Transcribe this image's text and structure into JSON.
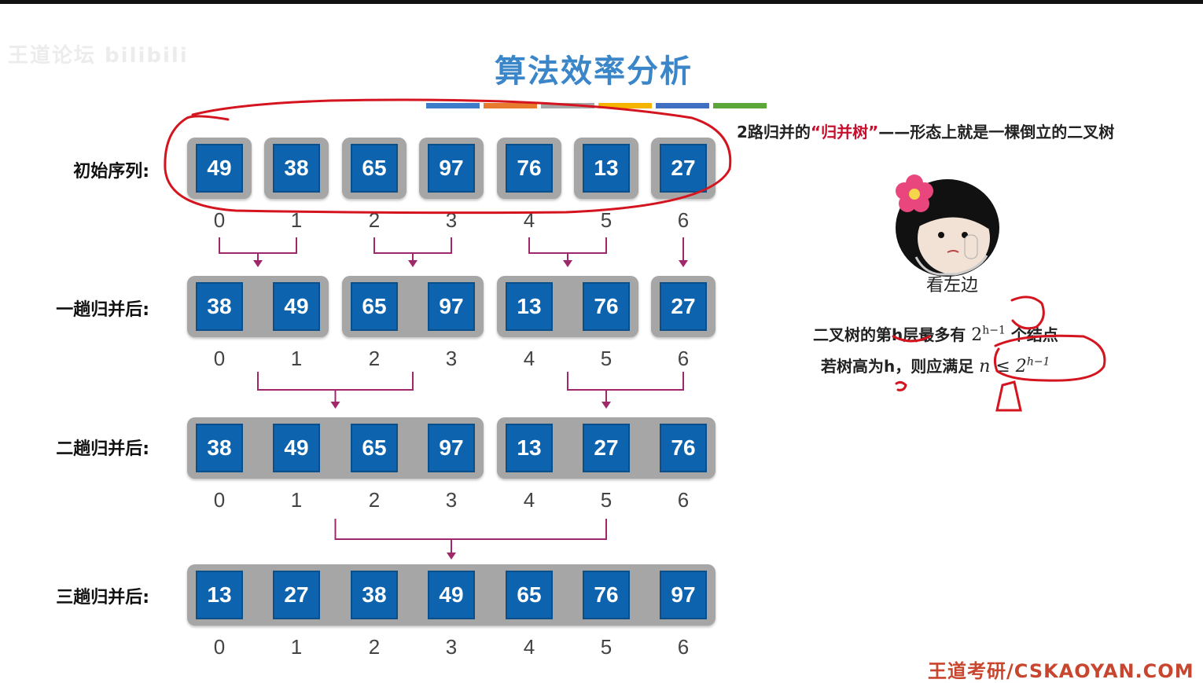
{
  "watermark": "王道论坛 bilibili",
  "title": "算法效率分析",
  "stripe_colors": [
    "#3d7cc9",
    "#e77a2d",
    "#a6a6a6",
    "#f5b400",
    "#3e6fc1",
    "#5ca63a"
  ],
  "rows": [
    {
      "label": "初始序列:",
      "values": [
        "49",
        "38",
        "65",
        "97",
        "76",
        "13",
        "27"
      ],
      "groups": [
        [
          0
        ],
        [
          1
        ],
        [
          2
        ],
        [
          3
        ],
        [
          4
        ],
        [
          5
        ],
        [
          6
        ]
      ]
    },
    {
      "label": "一趟归并后:",
      "values": [
        "38",
        "49",
        "65",
        "97",
        "13",
        "76",
        "27"
      ],
      "groups": [
        [
          0,
          1
        ],
        [
          2,
          3
        ],
        [
          4,
          5
        ],
        [
          6
        ]
      ]
    },
    {
      "label": "二趟归并后:",
      "values": [
        "38",
        "49",
        "65",
        "97",
        "13",
        "27",
        "76"
      ],
      "groups": [
        [
          0,
          1,
          2,
          3
        ],
        [
          4,
          5,
          6
        ]
      ]
    },
    {
      "label": "三趟归并后:",
      "values": [
        "13",
        "27",
        "38",
        "49",
        "65",
        "76",
        "97"
      ],
      "groups": [
        [
          0,
          1,
          2,
          3,
          4,
          5,
          6
        ]
      ]
    }
  ],
  "indices": [
    "0",
    "1",
    "2",
    "3",
    "4",
    "5",
    "6"
  ],
  "notes": {
    "line1_prefix": "2路归并的",
    "line1_highlight": "“归并树”",
    "line1_suffix": "——形态上就是一棵倒立的二叉树",
    "meme_caption": "看左边",
    "line2_prefix": "二叉树的第h层最多有",
    "line2_math": "2",
    "line2_exp": "h−1",
    "line2_suffix": "个结点",
    "line3_prefix": "若树高为h，则应满足",
    "line3_math": "n ≤ 2",
    "line3_exp": "h−1"
  },
  "footer": "王道考研/CSKAOYAN.COM",
  "colors": {
    "title": "#3a86c8",
    "cell": "#0d63ad",
    "arrow": "#a0286a",
    "ink": "#d4141e"
  }
}
